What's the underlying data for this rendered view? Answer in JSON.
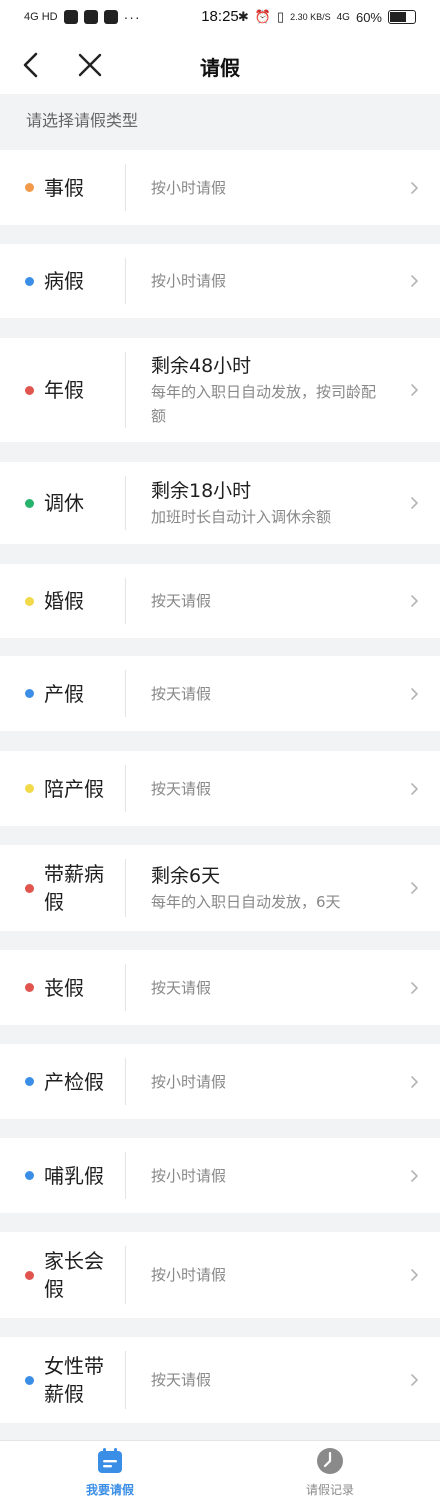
{
  "status_bar": {
    "network": "4G HD",
    "more": "···",
    "time": "18:25",
    "speed": "2.30 KB/S",
    "signal": "4G",
    "battery": "60%"
  },
  "nav": {
    "title": "请假"
  },
  "section_header": "请选择请假类型",
  "leave_types": [
    {
      "name": "事假",
      "dot_color": "#f39a4a",
      "title": "",
      "subtitle": "按小时请假"
    },
    {
      "name": "病假",
      "dot_color": "#3b8ee6",
      "title": "",
      "subtitle": "按小时请假"
    },
    {
      "name": "年假",
      "dot_color": "#e0554d",
      "title": "剩余48小时",
      "subtitle": "每年的入职日自动发放，按司龄配额"
    },
    {
      "name": "调休",
      "dot_color": "#26b36b",
      "title": "剩余18小时",
      "subtitle": "加班时长自动计入调休余额"
    },
    {
      "name": "婚假",
      "dot_color": "#f2d94a",
      "title": "",
      "subtitle": "按天请假"
    },
    {
      "name": "产假",
      "dot_color": "#3b8ee6",
      "title": "",
      "subtitle": "按天请假"
    },
    {
      "name": "陪产假",
      "dot_color": "#f2d94a",
      "title": "",
      "subtitle": "按天请假"
    },
    {
      "name": "带薪病假",
      "dot_color": "#e0554d",
      "title": "剩余6天",
      "subtitle": "每年的入职日自动发放，6天"
    },
    {
      "name": "丧假",
      "dot_color": "#e0554d",
      "title": "",
      "subtitle": "按天请假"
    },
    {
      "name": "产检假",
      "dot_color": "#3b8ee6",
      "title": "",
      "subtitle": "按小时请假"
    },
    {
      "name": "哺乳假",
      "dot_color": "#3b8ee6",
      "title": "",
      "subtitle": "按小时请假"
    },
    {
      "name": "家长会假",
      "dot_color": "#e0554d",
      "title": "",
      "subtitle": "按小时请假"
    },
    {
      "name": "女性带薪假",
      "dot_color": "#3b8ee6",
      "title": "",
      "subtitle": "按天请假"
    }
  ],
  "tabs": [
    {
      "label": "我要请假",
      "icon": "calendar-icon",
      "active": true
    },
    {
      "label": "请假记录",
      "icon": "clock-icon",
      "active": false
    }
  ],
  "colors": {
    "accent": "#3b8ee6",
    "inactive": "#8a8a8a"
  }
}
